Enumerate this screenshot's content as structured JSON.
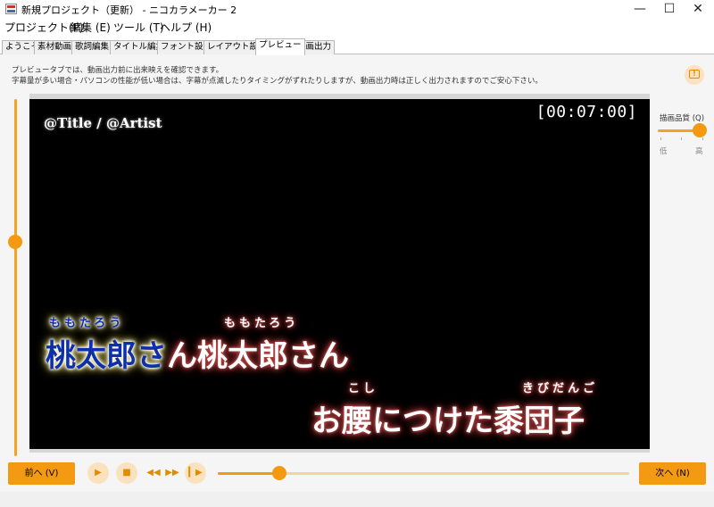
{
  "window": {
    "title": "新規プロジェクト（更新） - ニコカラメーカー 2",
    "minimize": "—",
    "maximize": "☐",
    "close": "✕"
  },
  "menu": [
    "プロジェクト(P)",
    "編集 (E)",
    "ツール (T)",
    "ヘルプ (H)"
  ],
  "tabs": [
    {
      "label": "ようこそ",
      "active": false
    },
    {
      "label": "素材動画",
      "active": false
    },
    {
      "label": "歌詞編集",
      "active": false
    },
    {
      "label": "タイトル編集",
      "active": false
    },
    {
      "label": "フォント設定",
      "active": false
    },
    {
      "label": "レイアウト設定",
      "active": false
    },
    {
      "label": "プレビュー",
      "active": true
    },
    {
      "label": "動画出力",
      "active": false
    }
  ],
  "info": {
    "line1": "プレビュータブでは、動画出力前に出来映えを確認できます。",
    "line2": "字幕量が多い場合・パソコンの性能が低い場合は、字幕が点滅したりタイミングがずれたりしますが、動画出力時は正しく出力されますのでご安心下さい。"
  },
  "preview": {
    "title_artist": "@Title / @Artist",
    "timecode": "[00:07:00]",
    "line1": {
      "sung": "桃太郎さ",
      "unsung": "ん桃太郎さん",
      "ruby_a": "ももたろう",
      "ruby_b": "ももたろう"
    },
    "line2": {
      "text": "お腰につけた黍団子",
      "ruby_a": "こし",
      "ruby_b": "きびだんご"
    }
  },
  "quality": {
    "label": "描画品質 (Q)",
    "low": "低",
    "high": "高",
    "level": 1.0
  },
  "controls": {
    "prev_label": "前へ (V)",
    "next_label": "次へ (N)",
    "play_icon": "▶",
    "stop_icon": "■",
    "rewind_icon": "◀◀",
    "forward_icon": "▶▶",
    "frame_icon": "▎▶",
    "seek_position": 0.15,
    "volume_position": 0.6
  },
  "colors": {
    "accent": "#f39a12",
    "sung_text": "#0d2fa8"
  }
}
